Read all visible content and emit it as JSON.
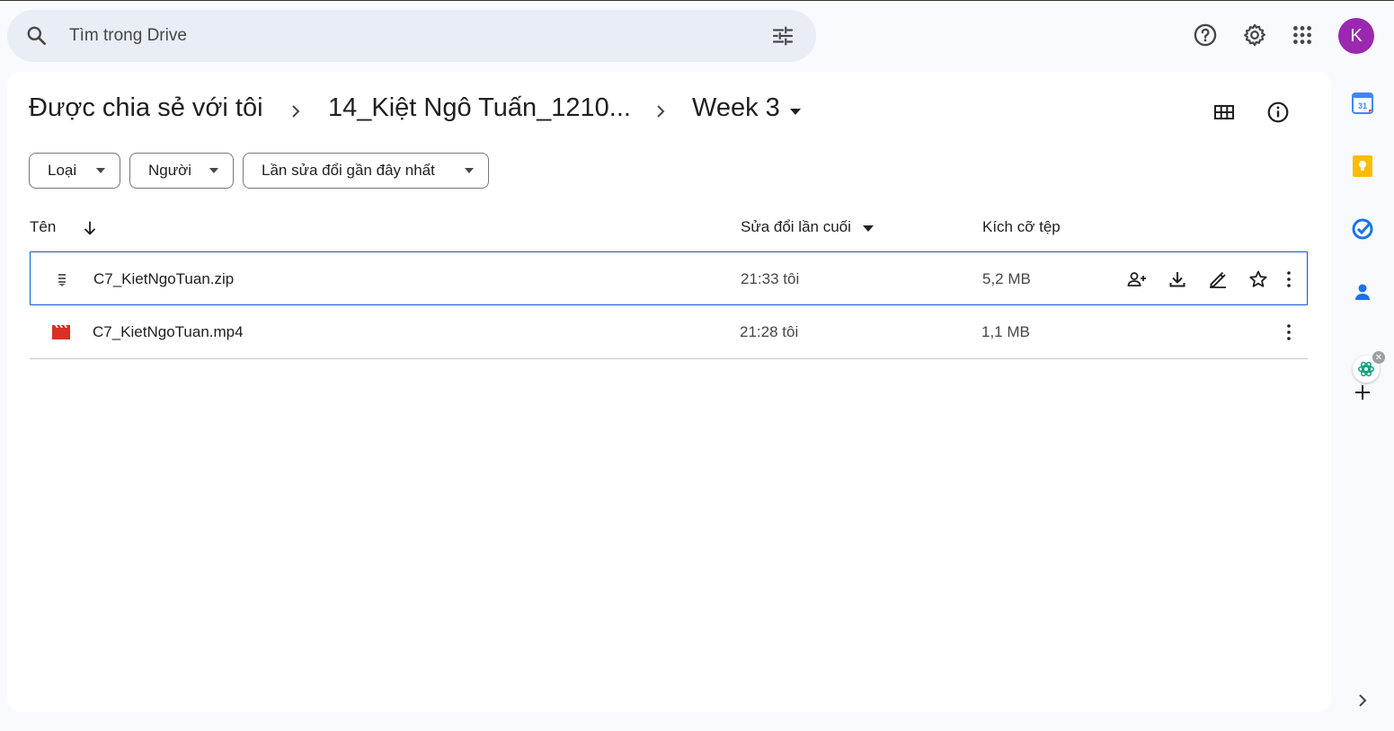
{
  "search": {
    "placeholder": "Tìm trong Drive"
  },
  "header": {
    "avatar_letter": "K",
    "avatar_color": "#9c27b0"
  },
  "breadcrumb": {
    "items": [
      "Được chia sẻ với tôi",
      "14_Kiệt Ngô Tuấn_1210...",
      "Week 3"
    ]
  },
  "filters": {
    "type": "Loại",
    "people": "Người",
    "modified": "Lần sửa đổi gần đây nhất"
  },
  "table": {
    "columns": {
      "name": "Tên",
      "modified": "Sửa đổi lần cuối",
      "size": "Kích cỡ tệp"
    },
    "rows": [
      {
        "name": "C7_KietNgoTuan.zip",
        "modified": "21:33 tôi",
        "size": "5,2 MB",
        "icon": "zip-file-icon",
        "selected": true
      },
      {
        "name": "C7_KietNgoTuan.mp4",
        "modified": "21:28 tôi",
        "size": "1,1 MB",
        "icon": "video-file-icon",
        "selected": false
      }
    ]
  },
  "colors": {
    "accent": "#0b57d0",
    "video_icon": "#d93025",
    "search_bg": "#e9eef6"
  }
}
